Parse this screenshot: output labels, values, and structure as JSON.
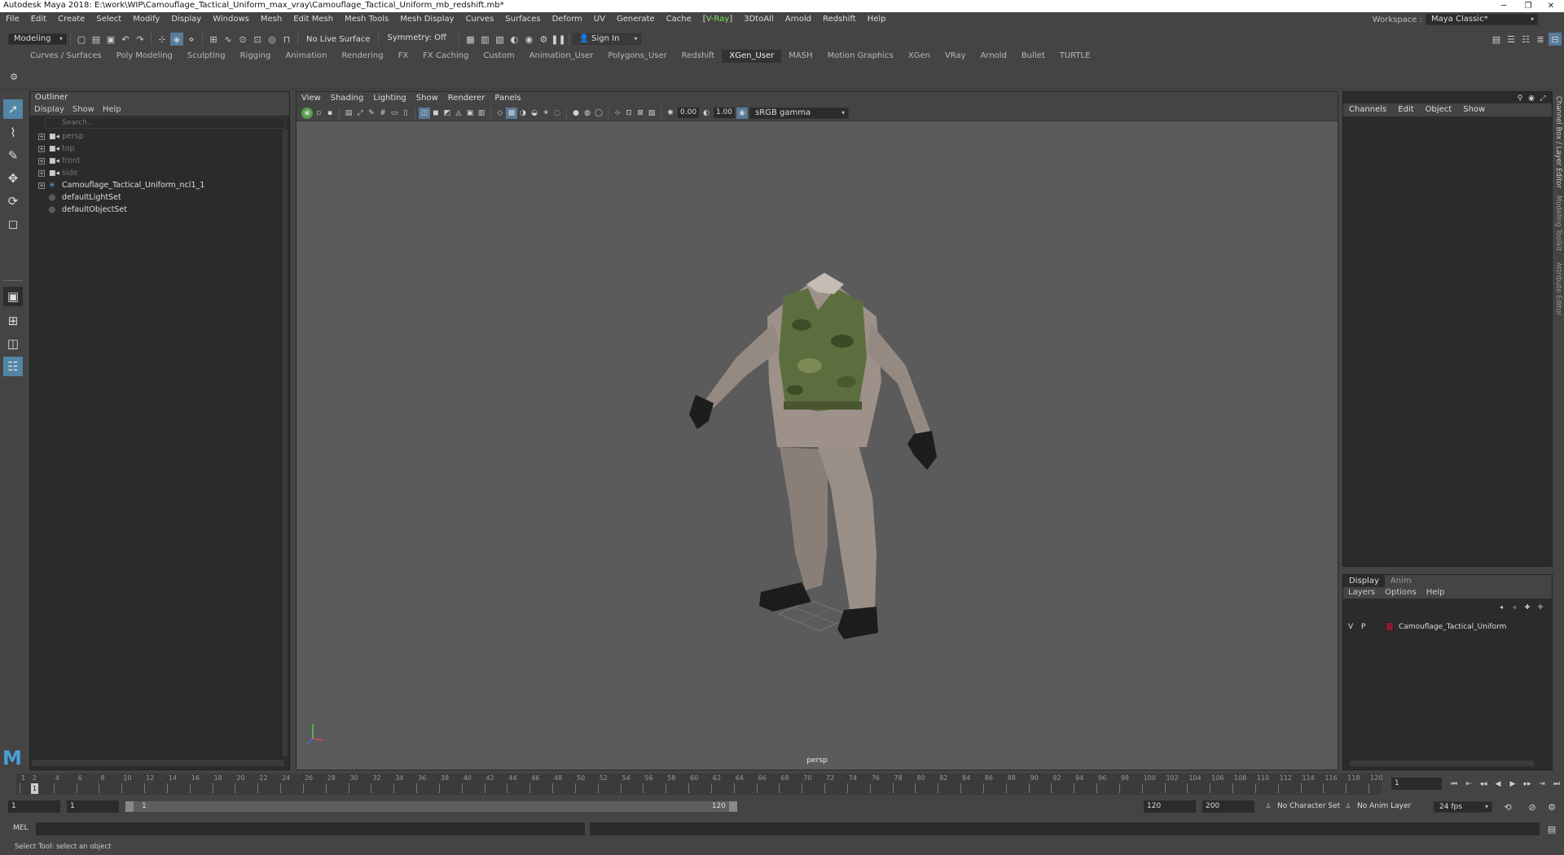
{
  "window": {
    "title": "Autodesk Maya 2018: E:\\work\\WIP\\Camouflage_Tactical_Uniform_max_vray\\Camouflage_Tactical_Uniform_mb_redshift.mb*",
    "minimize": "─",
    "restore": "❐",
    "close": "✕"
  },
  "menubar": {
    "items": [
      "File",
      "Edit",
      "Create",
      "Select",
      "Modify",
      "Display",
      "Windows",
      "Mesh",
      "Edit Mesh",
      "Mesh Tools",
      "Mesh Display",
      "Curves",
      "Surfaces",
      "Deform",
      "UV",
      "Generate",
      "Cache"
    ],
    "vray": "V-Ray",
    "items2": [
      "3DtoAll",
      "Arnold",
      "Redshift",
      "Help"
    ],
    "workspace_label": "Workspace :",
    "workspace_value": "Maya Classic*"
  },
  "statusline": {
    "mode": "Modeling",
    "live_surface": "No Live Surface",
    "symmetry": "Symmetry: Off",
    "sign_in": "Sign In"
  },
  "shelf": {
    "tabs": [
      "Curves / Surfaces",
      "Poly Modeling",
      "Sculpting",
      "Rigging",
      "Animation",
      "Rendering",
      "FX",
      "FX Caching",
      "Custom",
      "Animation_User",
      "Polygons_User",
      "Redshift",
      "XGen_User",
      "MASH",
      "Motion Graphics",
      "XGen",
      "VRay",
      "Arnold",
      "Bullet",
      "TURTLE"
    ],
    "active": "XGen_User"
  },
  "outliner": {
    "title": "Outliner",
    "menu": [
      "Display",
      "Show",
      "Help"
    ],
    "search_placeholder": "Search...",
    "items": [
      {
        "label": "persp",
        "type": "camera",
        "dim": true
      },
      {
        "label": "top",
        "type": "camera",
        "dim": true
      },
      {
        "label": "front",
        "type": "camera",
        "dim": true
      },
      {
        "label": "side",
        "type": "camera",
        "dim": true
      },
      {
        "label": "Camouflage_Tactical_Uniform_ncl1_1",
        "type": "group",
        "dim": false
      },
      {
        "label": "defaultLightSet",
        "type": "set",
        "dim": false
      },
      {
        "label": "defaultObjectSet",
        "type": "set",
        "dim": false
      }
    ]
  },
  "viewport": {
    "menu": [
      "View",
      "Shading",
      "Lighting",
      "Show",
      "Renderer",
      "Panels"
    ],
    "exposure": "0.00",
    "gamma": "1.00",
    "colorspace": "sRGB gamma",
    "camera": "persp"
  },
  "channelbox": {
    "menu": [
      "Channels",
      "Edit",
      "Object",
      "Show"
    ],
    "side_tabs": [
      "Channel Box / Layer Editor",
      "Modeling Toolkit",
      "Attribute Editor"
    ]
  },
  "layereditor": {
    "tabs": [
      "Display",
      "Anim"
    ],
    "menu": [
      "Layers",
      "Options",
      "Help"
    ],
    "layer": {
      "v": "V",
      "p": "P",
      "name": "Camouflage_Tactical_Uniform",
      "color": "#8b1a2a"
    }
  },
  "timeslider": {
    "labels": [
      "1",
      "2",
      "4",
      "6",
      "8",
      "10",
      "12",
      "14",
      "16",
      "18",
      "20",
      "22",
      "24",
      "26",
      "28",
      "30",
      "32",
      "34",
      "36",
      "38",
      "40",
      "42",
      "44",
      "46",
      "48",
      "50",
      "52",
      "54",
      "56",
      "58",
      "60",
      "62",
      "64",
      "66",
      "68",
      "70",
      "72",
      "74",
      "76",
      "78",
      "80",
      "82",
      "84",
      "86",
      "88",
      "90",
      "92",
      "94",
      "96",
      "98",
      "100",
      "102",
      "104",
      "106",
      "108",
      "110",
      "112",
      "114",
      "116",
      "118",
      "120"
    ],
    "current_frame": "1",
    "current_field": "1"
  },
  "range": {
    "start": "1",
    "start2": "1",
    "inner_start": "1",
    "inner_end": "120",
    "end": "120",
    "end2": "200",
    "character_set": "No Character Set",
    "anim_layer": "No Anim Layer",
    "fps": "24 fps"
  },
  "cmdline": {
    "label": "MEL"
  },
  "helpline": {
    "text": "Select Tool: select an object"
  }
}
